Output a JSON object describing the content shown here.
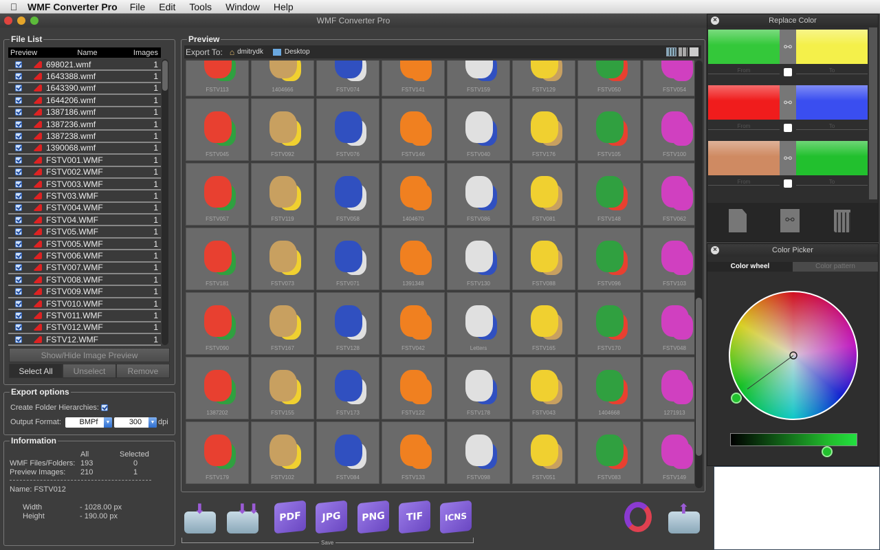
{
  "menubar": {
    "app": "WMF Converter Pro",
    "items": [
      "File",
      "Edit",
      "Tools",
      "Window",
      "Help"
    ]
  },
  "window": {
    "title": "WMF Converter Pro"
  },
  "file_list": {
    "legend": "File List",
    "columns": [
      "Preview",
      "Name",
      "Images"
    ],
    "rows": [
      [
        "698021.wmf",
        "1"
      ],
      [
        "1643388.wmf",
        "1"
      ],
      [
        "1643390.wmf",
        "1"
      ],
      [
        "1644206.wmf",
        "1"
      ],
      [
        "1387186.wmf",
        "1"
      ],
      [
        "1387236.wmf",
        "1"
      ],
      [
        "1387238.wmf",
        "1"
      ],
      [
        "1390068.wmf",
        "1"
      ],
      [
        "FSTV001.WMF",
        "1"
      ],
      [
        "FSTV002.WMF",
        "1"
      ],
      [
        "FSTV003.WMF",
        "1"
      ],
      [
        "FSTV03.WMF",
        "1"
      ],
      [
        "FSTV004.WMF",
        "1"
      ],
      [
        "FSTV04.WMF",
        "1"
      ],
      [
        "FSTV05.WMF",
        "1"
      ],
      [
        "FSTV005.WMF",
        "1"
      ],
      [
        "FSTV006.WMF",
        "1"
      ],
      [
        "FSTV007.WMF",
        "1"
      ],
      [
        "FSTV008.WMF",
        "1"
      ],
      [
        "FSTV009.WMF",
        "1"
      ],
      [
        "FSTV010.WMF",
        "1"
      ],
      [
        "FSTV011.WMF",
        "1"
      ],
      [
        "FSTV012.WMF",
        "1"
      ],
      [
        "FSTV12.WMF",
        "1"
      ]
    ],
    "show_hide": "Show/Hide Image Preview",
    "select_all": "Select All",
    "unselect": "Unselect",
    "remove": "Remove"
  },
  "export_options": {
    "legend": "Export options",
    "create_folder_label": "Create Folder Hierarchies:",
    "create_folder_checked": true,
    "output_format_label": "Output Format:",
    "format": "BMPf",
    "dpi": "300",
    "dpi_label": "dpi"
  },
  "information": {
    "legend": "Information",
    "col_all": "All",
    "col_selected": "Selected",
    "wmf_label": "WMF Files/Folders:",
    "wmf_all": "193",
    "wmf_selected": "0",
    "preview_label": "Preview Images:",
    "preview_all": "210",
    "preview_selected": "1",
    "name": "Name: FSTV012",
    "width_label": "Width",
    "width_value": "- 1028.00 px",
    "height_label": "Height",
    "height_value": "- 190.00 px"
  },
  "preview": {
    "legend": "Preview",
    "export_to": "Export To:",
    "path": [
      "dmitrydk",
      "Desktop"
    ],
    "tiles": [
      "FSTV113",
      "1404666",
      "FSTV074",
      "FSTV141",
      "FSTV159",
      "FSTV129",
      "FSTV050",
      "FSTV054",
      "FSTV045",
      "FSTV092",
      "FSTV076",
      "FSTV146",
      "FSTV040",
      "FSTV176",
      "FSTV105",
      "FSTV100",
      "FSTV057",
      "FSTV119",
      "FSTV058",
      "1404670",
      "FSTV086",
      "FSTV081",
      "FSTV148",
      "FSTV062",
      "FSTV181",
      "FSTV073",
      "FSTV071",
      "1391348",
      "FSTV130",
      "FSTV088",
      "FSTV096",
      "FSTV103",
      "FSTV090",
      "FSTV167",
      "FSTV128",
      "FSTV042",
      "Letters",
      "FSTV165",
      "FSTV170",
      "FSTV048",
      "1387202",
      "FSTV155",
      "FSTV173",
      "FSTV122",
      "FSTV178",
      "FSTV043",
      "1404668",
      "1271913",
      "FSTV179",
      "FSTV102",
      "FSTV084",
      "FSTV133",
      "FSTV098",
      "FSTV051",
      "FSTV083",
      "FSTV149"
    ]
  },
  "toolbar": {
    "formats": [
      "PDF",
      "JPG",
      "PNG",
      "TIF",
      "ICNS"
    ],
    "save_label": "Save"
  },
  "replace_color": {
    "title": "Replace Color",
    "from_label": "From",
    "to_label": "To",
    "pairs": [
      {
        "from": "#34c83a",
        "to": "#f4f04a"
      },
      {
        "from": "#f01c1c",
        "to": "#3a4ef0"
      },
      {
        "from": "#cf8a62",
        "to": "#22c02e"
      }
    ]
  },
  "color_picker": {
    "title": "Color Picker",
    "tabs": [
      "Color wheel",
      "Color pattern"
    ],
    "active_tab": "Color wheel",
    "selected_color": "#22c02e"
  }
}
